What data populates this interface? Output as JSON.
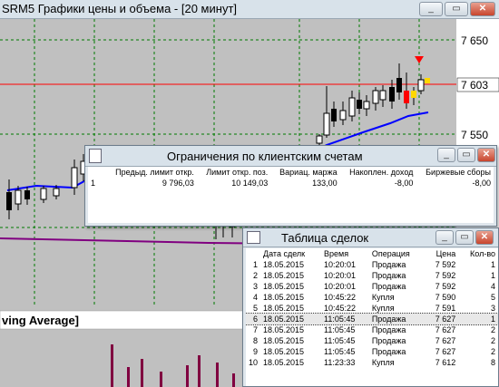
{
  "chart_window": {
    "title": "SRM5 Графики цены и объема - [20 минут]",
    "price_labels": [
      "7 650",
      "7 603",
      "7 550"
    ],
    "indicator_label": "ving Average]",
    "buttons": {
      "minimize": "_",
      "restore": "▭",
      "close": "✕"
    }
  },
  "chart_data": {
    "type": "candlestick",
    "title": "SRM5 Графики цены и объема - [20 минут]",
    "y_ticks": [
      7650,
      7603,
      7550
    ],
    "current_price": 7603,
    "price_line_color": "#ff0000",
    "moving_average_color": "#0000ff",
    "grid": true,
    "indicator_panel": "ving Average]",
    "volume_bar_color": "#800040"
  },
  "limits_window": {
    "title": "Ограничения по клиентским счетам",
    "headers": [
      "",
      "Предыд. лимит откр.",
      "Лимит откр. поз.",
      "Вариац. маржа",
      "Накоплен. доход",
      "Биржевые сборы"
    ],
    "rows": [
      [
        "1",
        "9 796,03",
        "10 149,03",
        "133,00",
        "-8,00",
        "-8,00"
      ]
    ]
  },
  "deals_window": {
    "title": "Таблица сделок",
    "headers": [
      "",
      "Дата сделк",
      "Время",
      "Операция",
      "Цена",
      "Кол-во"
    ],
    "rows": [
      [
        "1",
        "18.05.2015",
        "10:20:01",
        "Продажа",
        "7 592",
        "1"
      ],
      [
        "2",
        "18.05.2015",
        "10:20:01",
        "Продажа",
        "7 592",
        "1"
      ],
      [
        "3",
        "18.05.2015",
        "10:20:01",
        "Продажа",
        "7 592",
        "4"
      ],
      [
        "4",
        "18.05.2015",
        "10:45:22",
        "Купля",
        "7 590",
        "5"
      ],
      [
        "5",
        "18.05.2015",
        "10:45:22",
        "Купля",
        "7 591",
        "3"
      ],
      [
        "6",
        "18.05.2015",
        "11:05:45",
        "Продажа",
        "7 627",
        "1"
      ],
      [
        "7",
        "18.05.2015",
        "11:05:45",
        "Продажа",
        "7 627",
        "2"
      ],
      [
        "8",
        "18.05.2015",
        "11:05:45",
        "Продажа",
        "7 627",
        "2"
      ],
      [
        "9",
        "18.05.2015",
        "11:05:45",
        "Продажа",
        "7 627",
        "2"
      ],
      [
        "10",
        "18.05.2015",
        "11:23:33",
        "Купля",
        "7 612",
        "8"
      ]
    ],
    "selected_row": 5
  }
}
